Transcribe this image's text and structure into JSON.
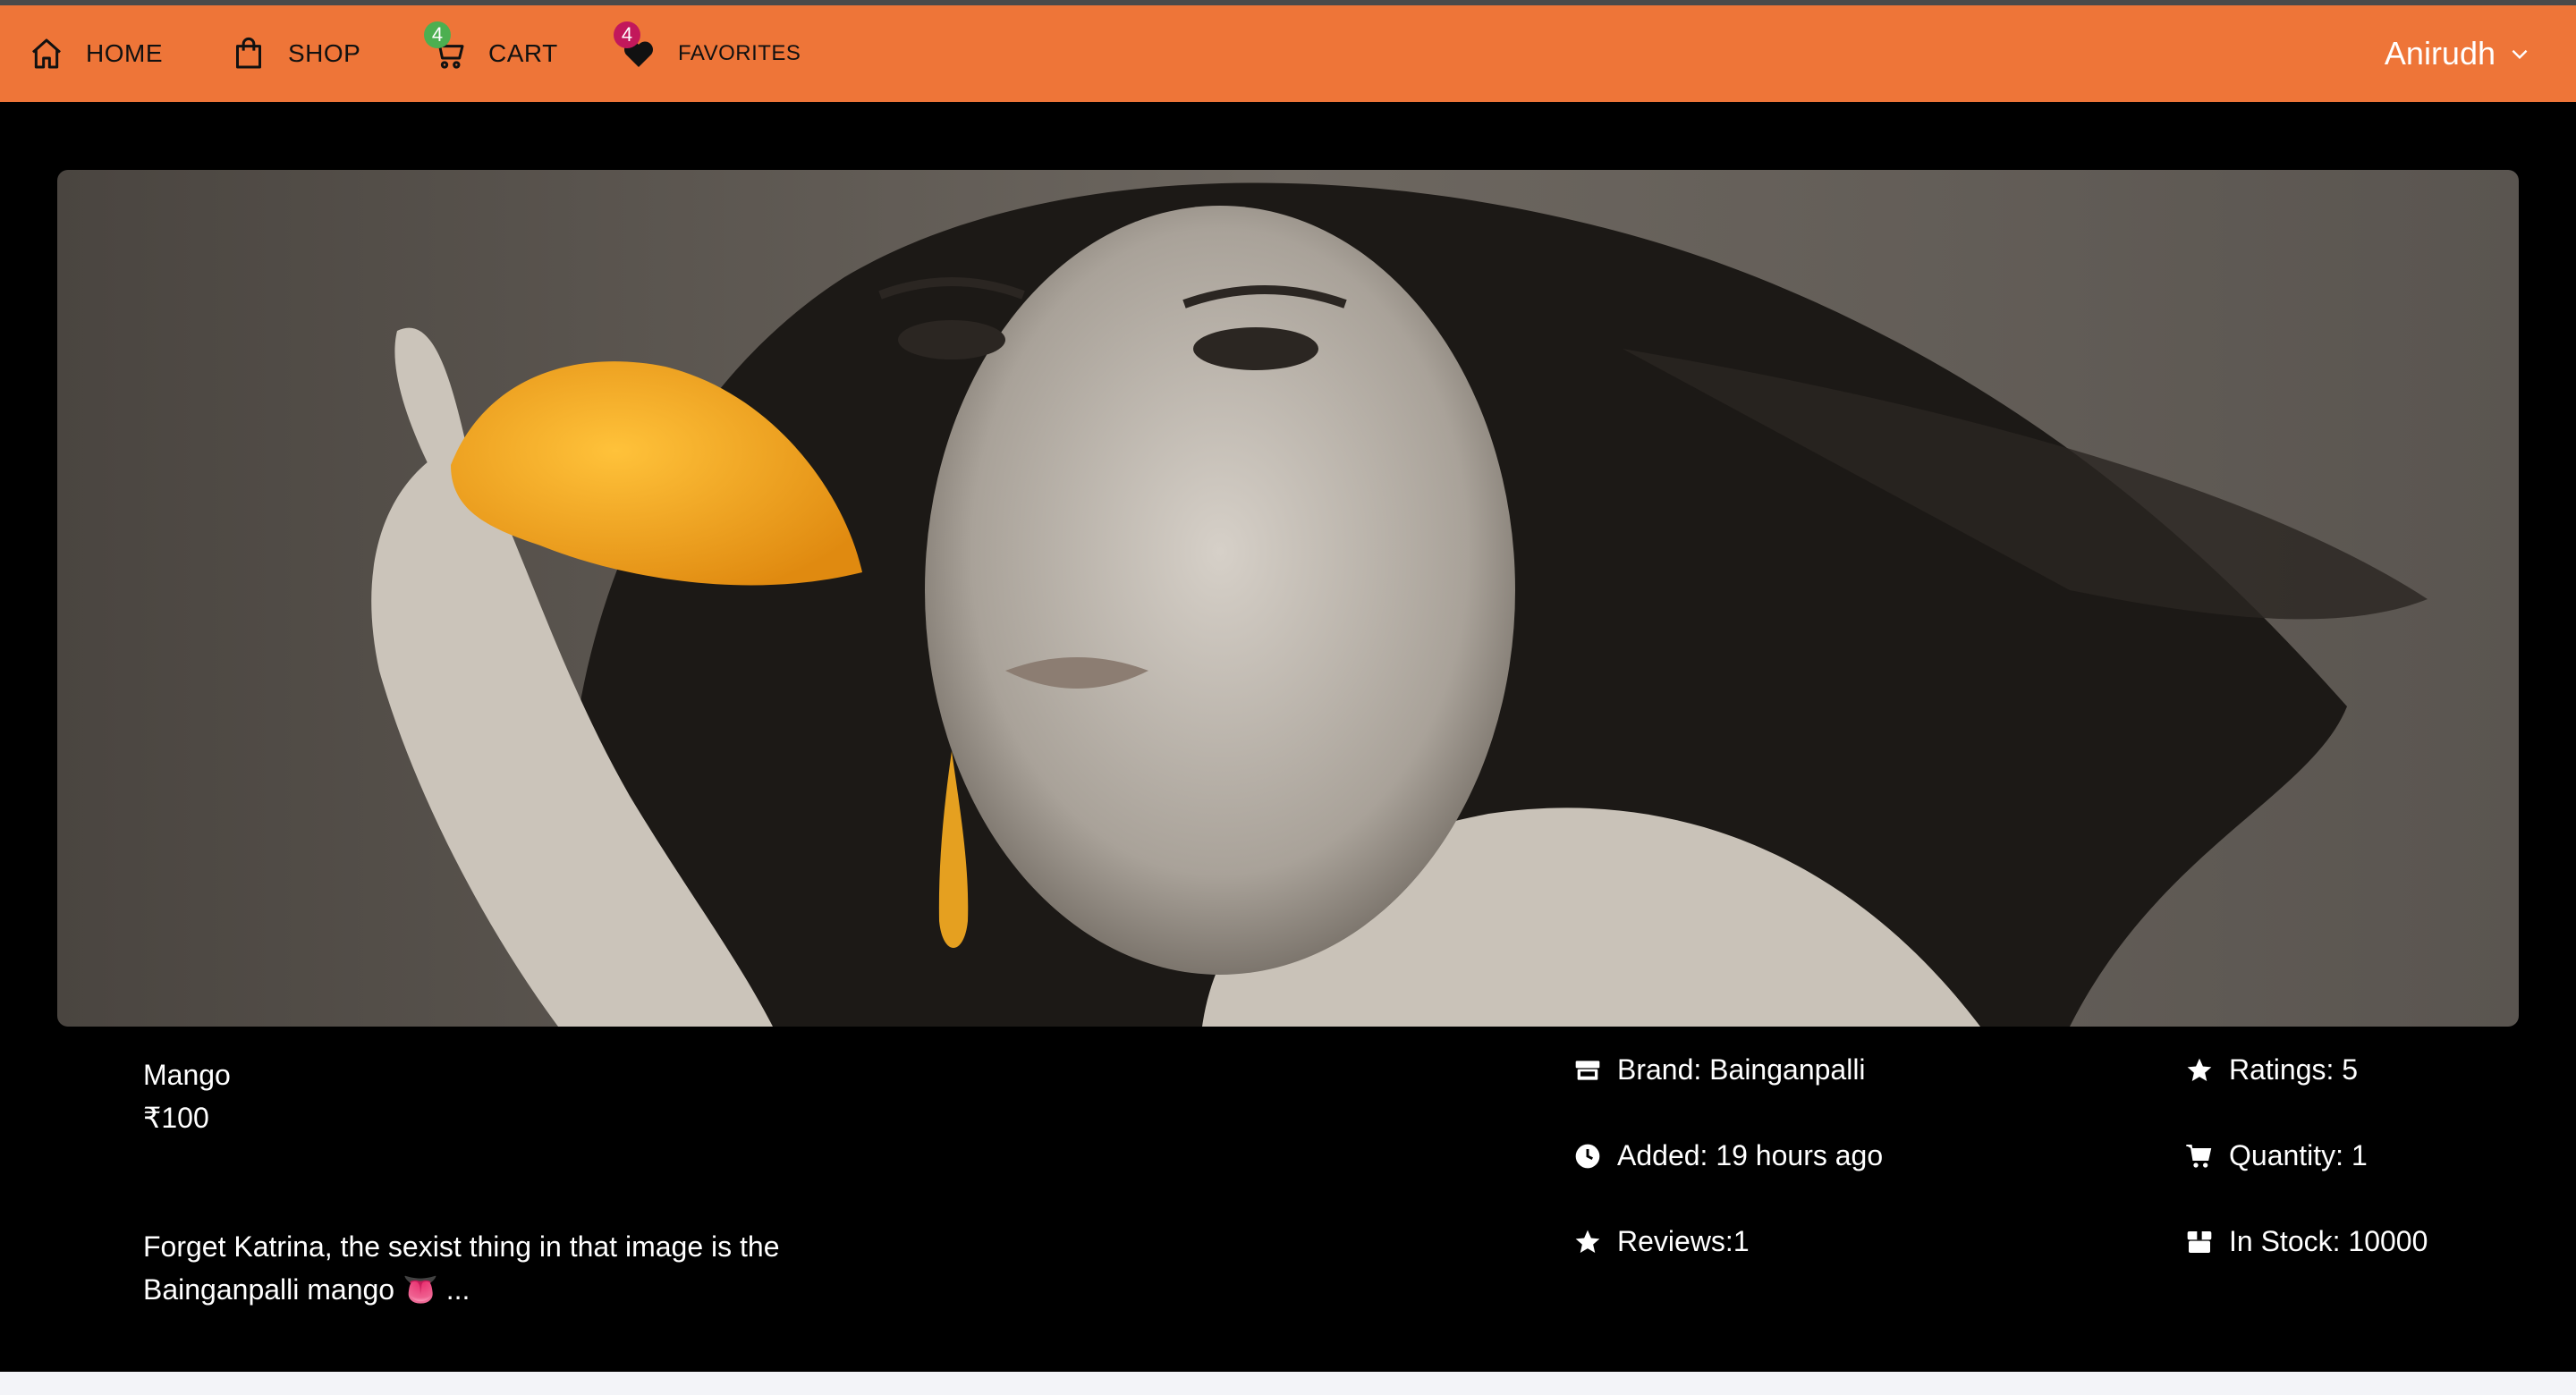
{
  "nav": {
    "home": {
      "label": "HOME",
      "icon": "home-icon"
    },
    "shop": {
      "label": "SHOP",
      "icon": "shopping-bag-icon"
    },
    "cart": {
      "label": "CART",
      "icon": "cart-icon",
      "badge": "4",
      "badge_color": "#4caf50"
    },
    "favorites": {
      "label": "FAVORITES",
      "icon": "heart-icon",
      "badge": "4",
      "badge_color": "#c2185b"
    },
    "user": {
      "name": "Anirudh",
      "icon": "chevron-down-icon"
    }
  },
  "colors": {
    "nav_bg": "#ee7538",
    "page_bg": "#000000",
    "text": "#ffffff"
  },
  "product": {
    "name": "Mango",
    "price": "₹100",
    "description": "Forget Katrina, the sexist thing in that image is the Bainganpalli mango 👅 ...",
    "brand": "Brand: Bainganpalli",
    "added": "Added: 19 hours ago",
    "reviews": "Reviews:1",
    "ratings": "Ratings: 5",
    "quantity": "Quantity: 1",
    "in_stock": "In Stock: 10000"
  }
}
